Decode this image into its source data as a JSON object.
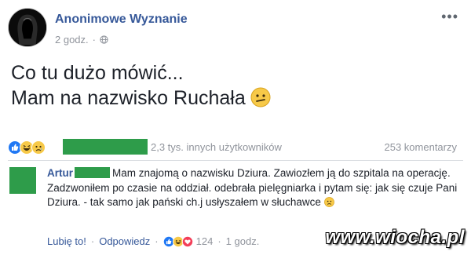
{
  "post": {
    "author": "Anonimowe Wyznanie",
    "time": "2 godz.",
    "dot": "·",
    "text_lines": [
      "Co tu dużo mówić...",
      "Mam na nazwisko Ruchała"
    ],
    "more_label": "•••"
  },
  "reactions": {
    "icons": [
      "like-icon",
      "haha-icon",
      "sad-icon"
    ],
    "others_text": "2,3 tys. innych użytkowników",
    "comments_count": "253 komentarzy"
  },
  "comment": {
    "author": "Artur",
    "text": "Mam znajomą o nazwisku Dziura. Zawiozłem ją do szpitala na operację. Zadzwoniłem po czasie na oddział. odebrała pielęgniarka i pytam się: jak się czuje Pani Dziura. - tak samo jak pański ch.j usłyszałem w słuchawce",
    "like_label": "Lubię to!",
    "reply_label": "Odpowiedz",
    "reaction_count": "124",
    "time": "1 godz.",
    "sep": "·"
  },
  "watermark": "www.wiocha.pl",
  "colors": {
    "link": "#365899",
    "meta": "#90949c",
    "censor": "#2e9c4a"
  }
}
